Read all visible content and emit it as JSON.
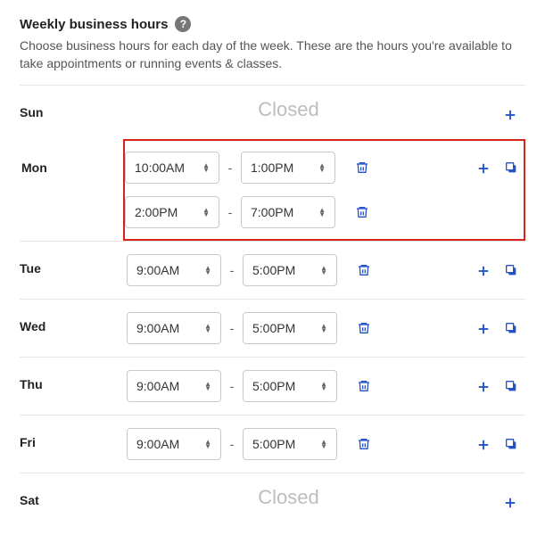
{
  "header": {
    "title": "Weekly business hours",
    "desc": "Choose business hours for each day of the week. These are the hours you're available to take appointments or running events & classes."
  },
  "closed_label": "Closed",
  "days": [
    {
      "label": "Sun",
      "closed": true,
      "highlight": false,
      "show_copy": false,
      "slots": []
    },
    {
      "label": "Mon",
      "closed": false,
      "highlight": true,
      "show_copy": true,
      "slots": [
        {
          "start": "10:00AM",
          "end": "1:00PM"
        },
        {
          "start": "2:00PM",
          "end": "7:00PM"
        }
      ]
    },
    {
      "label": "Tue",
      "closed": false,
      "highlight": false,
      "show_copy": true,
      "slots": [
        {
          "start": "9:00AM",
          "end": "5:00PM"
        }
      ]
    },
    {
      "label": "Wed",
      "closed": false,
      "highlight": false,
      "show_copy": true,
      "slots": [
        {
          "start": "9:00AM",
          "end": "5:00PM"
        }
      ]
    },
    {
      "label": "Thu",
      "closed": false,
      "highlight": false,
      "show_copy": true,
      "slots": [
        {
          "start": "9:00AM",
          "end": "5:00PM"
        }
      ]
    },
    {
      "label": "Fri",
      "closed": false,
      "highlight": false,
      "show_copy": true,
      "slots": [
        {
          "start": "9:00AM",
          "end": "5:00PM"
        }
      ]
    },
    {
      "label": "Sat",
      "closed": true,
      "highlight": false,
      "show_copy": false,
      "slots": []
    }
  ]
}
